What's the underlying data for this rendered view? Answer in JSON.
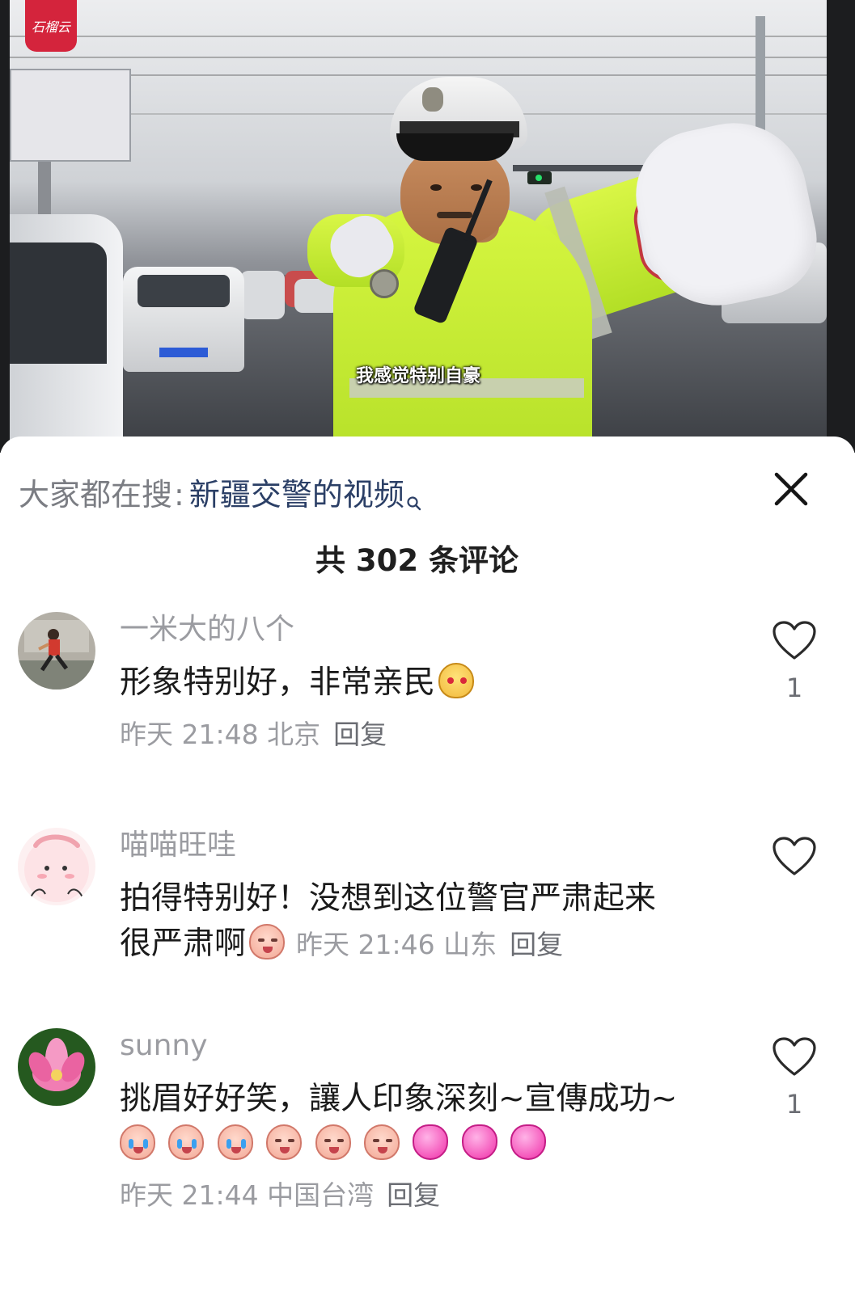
{
  "video": {
    "app_logo_text": "石榴云",
    "subtitle": "我感觉特别自豪"
  },
  "search_hint": {
    "prefix": "大家都在搜",
    "separator": ":",
    "term": "新疆交警的视频",
    "icon": "search-icon"
  },
  "close_icon": "close-icon",
  "comments_header": {
    "title": "共 302 条评论"
  },
  "comments": [
    {
      "username": "一米大的八个",
      "text": "形象特别好，非常亲民",
      "emojis": [
        "peach-face-emoji"
      ],
      "time": "昨天 21:48",
      "location": "北京",
      "reply_label": "回复",
      "like_count": "1",
      "avatar_colors": [
        "#a7a39b",
        "#6f7467"
      ]
    },
    {
      "username": "喵喵旺哇",
      "text_line1": "拍得特别好！没想到这位警官严肃起来",
      "text_line2": "很严肃啊",
      "emojis": [
        "serious-face-emoji"
      ],
      "time": "昨天 21:46",
      "location": "山东",
      "reply_label": "回复",
      "like_count": "",
      "avatar_colors": [
        "#fde3e6",
        "#f4b3bd"
      ]
    },
    {
      "username": "sunny",
      "text": "挑眉好好笑，讓人印象深刻~宣傳成功~",
      "emojis": [
        "crying-laugh-emoji",
        "crying-laugh-emoji",
        "crying-laugh-emoji",
        "laugh-emoji",
        "laugh-emoji",
        "laugh-emoji",
        "heart-emoji",
        "heart-emoji",
        "heart-emoji"
      ],
      "time": "昨天 21:44",
      "location": "中国台湾",
      "reply_label": "回复",
      "like_count": "1",
      "avatar_colors": [
        "#2d6b2a",
        "#ec5fa2"
      ]
    }
  ]
}
